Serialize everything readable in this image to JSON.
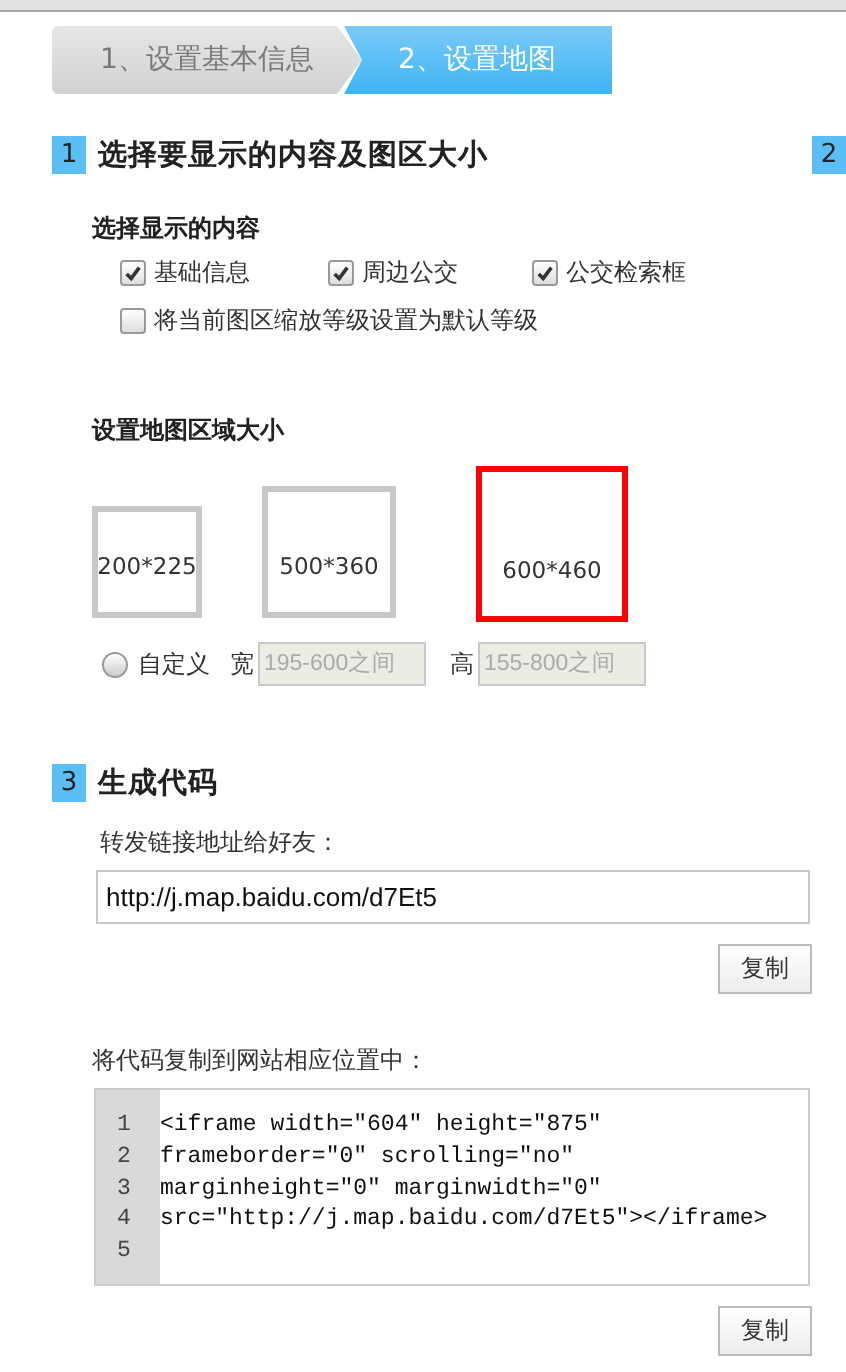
{
  "steps": [
    {
      "label": "1、设置基本信息",
      "selected": false
    },
    {
      "label": "2、设置地图",
      "selected": true
    }
  ],
  "section_1": {
    "number": "1",
    "title": "选择要显示的内容及图区大小",
    "next_number": "2",
    "content": {
      "heading": "选择显示的内容",
      "options": [
        {
          "label": "基础信息",
          "checked": true
        },
        {
          "label": "周边公交",
          "checked": true
        },
        {
          "label": "公交检索框",
          "checked": true
        },
        {
          "label": "将当前图区缩放等级设置为默认等级",
          "checked": false
        }
      ]
    },
    "size": {
      "heading": "设置地图区域大小",
      "presets": [
        {
          "label": "200*225",
          "selected": false
        },
        {
          "label": "500*360",
          "selected": false
        },
        {
          "label": "600*460",
          "selected": true
        }
      ],
      "custom": {
        "label": "自定义",
        "selected": false,
        "width_label": "宽",
        "width_placeholder": "195-600之间",
        "height_label": "高",
        "height_placeholder": "155-800之间"
      }
    }
  },
  "section_3": {
    "number": "3",
    "title": "生成代码",
    "link_label": "转发链接地址给好友：",
    "link_value": "http://j.map.baidu.com/d7Et5",
    "link_button": "复制",
    "code_label": "将代码复制到网站相应位置中：",
    "line_numbers": [
      "1",
      "2",
      "3",
      "4",
      "5"
    ],
    "code_lines": [
      "<iframe width=″604″ height=″875″",
      "frameborder=″0″ scrolling=″no″",
      "marginheight=″0″ marginwidth=″0″",
      "src=″http://j.map.baidu.com/d7Et5″></iframe>"
    ],
    "code_button": "复制"
  }
}
